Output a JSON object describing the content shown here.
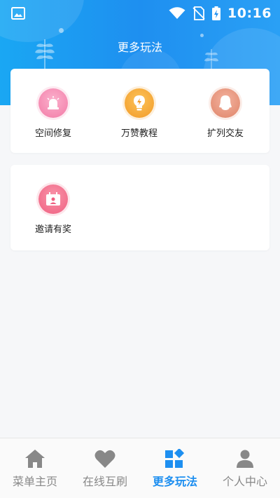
{
  "status_bar": {
    "time": "10:16"
  },
  "page": {
    "title": "更多玩法"
  },
  "card1": {
    "items": [
      {
        "label": "空间修复",
        "icon": "alarm-light-icon",
        "color": "#f58bb3"
      },
      {
        "label": "万赞教程",
        "icon": "lightbulb-icon",
        "color": "#f5a83a"
      },
      {
        "label": "扩列交友",
        "icon": "penguin-icon",
        "color": "#e89a82"
      }
    ]
  },
  "card2": {
    "items": [
      {
        "label": "邀请有奖",
        "icon": "invite-card-icon",
        "color": "#f2728f"
      }
    ]
  },
  "tabbar": {
    "tabs": [
      {
        "label": "菜单主页",
        "icon": "home-icon",
        "active": false
      },
      {
        "label": "在线互刷",
        "icon": "heart-icon",
        "active": false
      },
      {
        "label": "更多玩法",
        "icon": "grid-icon",
        "active": true
      },
      {
        "label": "个人中心",
        "icon": "person-icon",
        "active": false
      }
    ],
    "active_color": "#1e8ff0",
    "inactive_color": "#888888"
  }
}
